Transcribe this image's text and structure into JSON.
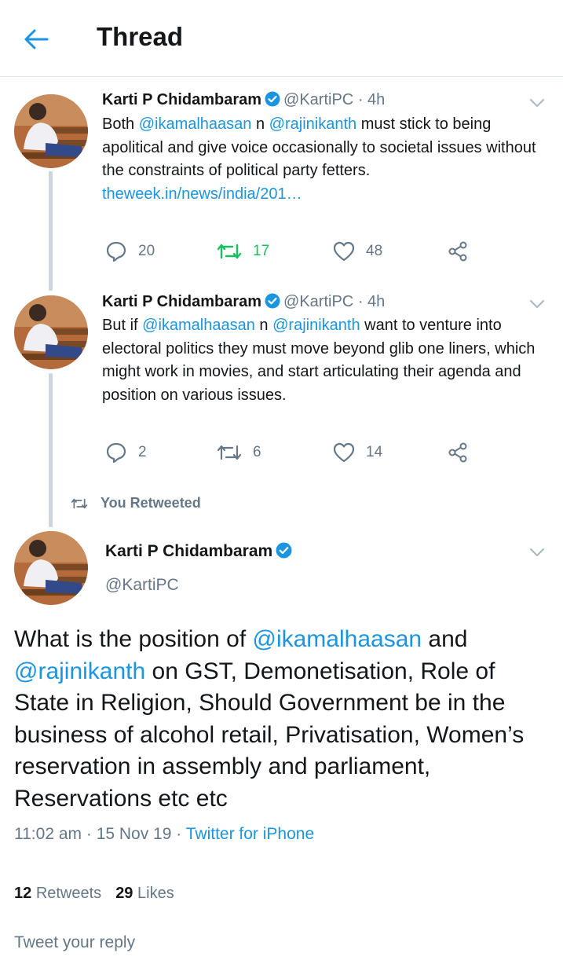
{
  "header": {
    "title": "Thread",
    "back_icon": "back-arrow-icon"
  },
  "colors": {
    "accent": "#1b95e0",
    "retweet_active": "#17bf63",
    "muted": "#657786",
    "text": "#14171a",
    "divider": "#e1e8ed"
  },
  "tweets": [
    {
      "author": "Karti P Chidambaram",
      "handle": "@KartiPC",
      "dot": "·",
      "time": "4h",
      "text": {
        "p1": "Both ",
        "m1": "@ikamalhaasan",
        "p2": " n ",
        "m2": "@rajinikanth",
        "p3": " must stick to being apolitical and give voice occasionally to societal issues without the constraints of political party fetters.",
        "link": "theweek.in/news/india/201…"
      },
      "replies": "20",
      "retweets": "17",
      "likes": "48"
    },
    {
      "author": "Karti P Chidambaram",
      "handle": "@KartiPC",
      "dot": "·",
      "time": "4h",
      "text": {
        "p1": "But if ",
        "m1": "@ikamalhaasan",
        "p2": " n ",
        "m2": "@rajinikanth",
        "p3": " want to venture into electoral politics they must move beyond glib one liners, which might work in movies, and start articulating their agenda and position on various issues."
      },
      "replies": "2",
      "retweets": "6",
      "likes": "14"
    }
  ],
  "you_retweeted": "You Retweeted",
  "main_tweet": {
    "author": "Karti P Chidambaram",
    "handle": "@KartiPC",
    "text": {
      "p1": "What is the position of ",
      "m1": "@ikamalhaasan",
      "p2": " and ",
      "m2": "@rajinikanth",
      "p3": " on GST, Demonetisation, Role of State in Religion, Should Government be in the business of alcohol retail, Privatisation, Women’s reservation in assembly and parliament, Reservations etc etc"
    },
    "time": "11:02 am",
    "sep1": "·",
    "date": "15 Nov 19",
    "sep2": "·",
    "source": "Twitter for iPhone",
    "retweets_count": "12",
    "retweets_label": "Retweets",
    "likes_count": "29",
    "likes_label": "Likes"
  },
  "reply_placeholder": "Tweet your reply"
}
